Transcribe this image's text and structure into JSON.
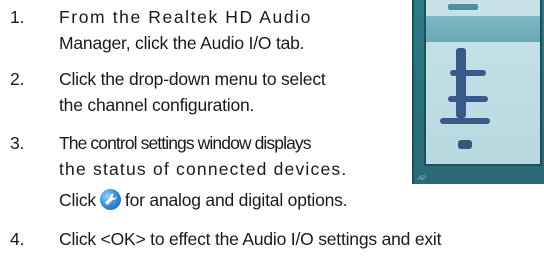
{
  "steps": [
    {
      "num": "1.",
      "lines": [
        "From the Realtek HD Audio",
        "Manager, click the Audio I/O tab."
      ]
    },
    {
      "num": "2.",
      "lines": [
        "Click the drop-down menu to select",
        "the channel configuration."
      ]
    },
    {
      "num": "3.",
      "lines": [
        "The control settings window displays",
        "the status of connected devices.",
        "Click",
        "for analog and digital options."
      ]
    },
    {
      "num": "4.",
      "lines": [
        "Click <OK> to effect the Audio I/O settings and exit"
      ]
    }
  ],
  "icons": {
    "settings_icon": "wrench-settings-icon"
  },
  "screenshot": {
    "footer_text": "AP"
  }
}
